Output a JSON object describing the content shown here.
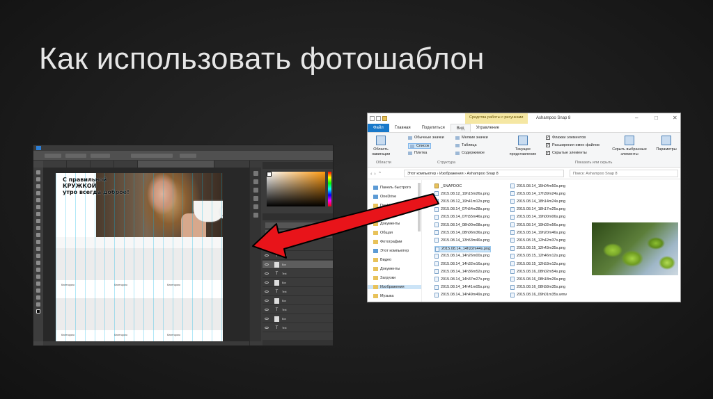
{
  "slide": {
    "title": "Как использовать фотошаблон"
  },
  "photoshop": {
    "canvas": {
      "headline_line1": "С правильной КРУЖКОЙ",
      "headline_line2": "утро всегда доброе!",
      "category_label": "Категория"
    },
    "layers": [
      {
        "name": "Text",
        "type": "text"
      },
      {
        "name": "Text",
        "type": "text"
      },
      {
        "name": "Box",
        "type": "image"
      },
      {
        "name": "Text",
        "type": "text"
      },
      {
        "name": "Box",
        "type": "image"
      },
      {
        "name": "Text",
        "type": "text"
      },
      {
        "name": "Box",
        "type": "image"
      },
      {
        "name": "Text",
        "type": "text"
      },
      {
        "name": "Box",
        "type": "image"
      },
      {
        "name": "Text",
        "type": "text"
      }
    ],
    "colors": {
      "guide": "#00b4e6",
      "selection": "#5d5d5d"
    }
  },
  "explorer": {
    "context_tab": "Средства работы с рисунками",
    "window_title": "Ashampoo Snap 8",
    "tabs": [
      "Файл",
      "Главная",
      "Поделиться",
      "Вид",
      "Управление"
    ],
    "ribbon": {
      "nav_area": "Область навигации",
      "icons_large": "Обычные значки",
      "icons_medium": "Мелкие значки",
      "list": "Список",
      "table": "Таблица",
      "tile": "Плитка",
      "content": "Содержимое",
      "current_view": "Текущее представление",
      "checkbox_item_flags": "Флажки элементов",
      "checkbox_extensions": "Расширения имен файлов",
      "checkbox_hidden": "Скрытые элементы",
      "hide_selected": "Скрыть выбранные элементы",
      "options": "Параметры",
      "group_areas": "Области",
      "group_structure": "Структура",
      "group_show_hide": "Показать или скрыть"
    },
    "address": {
      "path": "Этот компьютер › Изображения › Ashampoo Snap 8",
      "search_placeholder": "Поиск: Ashampoo Snap 8"
    },
    "nav_pane": [
      {
        "label": "Панель быстрого",
        "kind": "star"
      },
      {
        "label": "OneDrive",
        "kind": "cloud"
      },
      {
        "label": "Desktop",
        "kind": "folder"
      },
      {
        "label": "WebMaster",
        "kind": "folder"
      },
      {
        "label": "Документы",
        "kind": "folder"
      },
      {
        "label": "Общая",
        "kind": "folder"
      },
      {
        "label": "Фотографии",
        "kind": "folder"
      },
      {
        "label": "Этот компьютер",
        "kind": "pc"
      },
      {
        "label": "Видео",
        "kind": "folder"
      },
      {
        "label": "Документы",
        "kind": "folder"
      },
      {
        "label": "Загрузки",
        "kind": "folder"
      },
      {
        "label": "Изображения",
        "kind": "folder",
        "selected": true
      },
      {
        "label": "Музыка",
        "kind": "folder"
      }
    ],
    "files_col1": [
      "_SNAPDOC",
      "2015.08.12_19h15m26s.png",
      "2015.08.12_19h41m12s.png",
      "2015.08.14_07h54m28s.png",
      "2015.08.14_07h55m46s.png",
      "2015.08.14_08h00m08s.png",
      "2015.08.14_08h06m36s.png",
      "2015.08.14_13h53m46s.png",
      "2015.08.14_14h22m44s.png",
      "2015.08.14_14h26m00s.png",
      "2015.08.14_14h32m16s.png",
      "2015.08.14_14h36m52s.png",
      "2015.08.14_14h37m27s.png",
      "2015.08.14_14h41m05s.png",
      "2015.08.14_14h49m49s.png"
    ],
    "files_col2": [
      "2015.08.14_15h04m50s.png",
      "2015.08.14_17h39m24s.png",
      "2015.08.14_18h14m24s.png",
      "2015.08.14_18h17m25s.png",
      "2015.08.14_19h00m06s.png",
      "2015.08.14_19h02m56s.png",
      "2015.08.14_19h20m46s.png",
      "2015.08.15_12h42m37s.png",
      "2015.08.15_12h43m35s.png",
      "2015.08.15_12h46m12s.png",
      "2015.08.15_12h53m12s.png",
      "2015.08.16_08h02m54s.png",
      "2015.08.16_08h18m26s.png",
      "2015.08.16_08h58m35s.png",
      "2015.08.16_09h01m35s.wmv"
    ],
    "selected_file_index": 8
  },
  "arrow": {
    "color": "#e8141a"
  }
}
